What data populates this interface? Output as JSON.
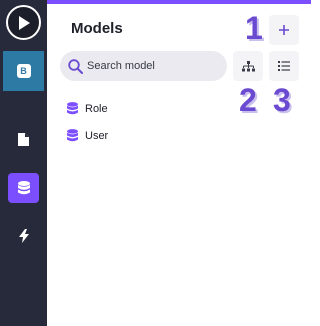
{
  "sidebar": {
    "logo_letter": "B",
    "items": [
      {
        "icon": "play-icon"
      },
      {
        "icon": "logo-icon"
      },
      {
        "icon": "file-icon"
      },
      {
        "icon": "database-icon",
        "active": true
      },
      {
        "icon": "bolt-icon"
      }
    ]
  },
  "main": {
    "title": "Models",
    "search": {
      "placeholder": "Search model",
      "value": ""
    },
    "toolbar": {
      "add_icon": "plus-icon",
      "tree_icon": "hierarchy-icon",
      "list_icon": "list-icon"
    },
    "annotations": [
      "1",
      "2",
      "3"
    ],
    "models": [
      {
        "label": "Role",
        "icon": "database-icon"
      },
      {
        "label": "User",
        "icon": "database-icon"
      }
    ]
  },
  "colors": {
    "sidebar_bg": "#272a3a",
    "accent": "#7b4fff",
    "logo_bg": "#2d7aa4",
    "annotation": "#6a4ad0"
  }
}
